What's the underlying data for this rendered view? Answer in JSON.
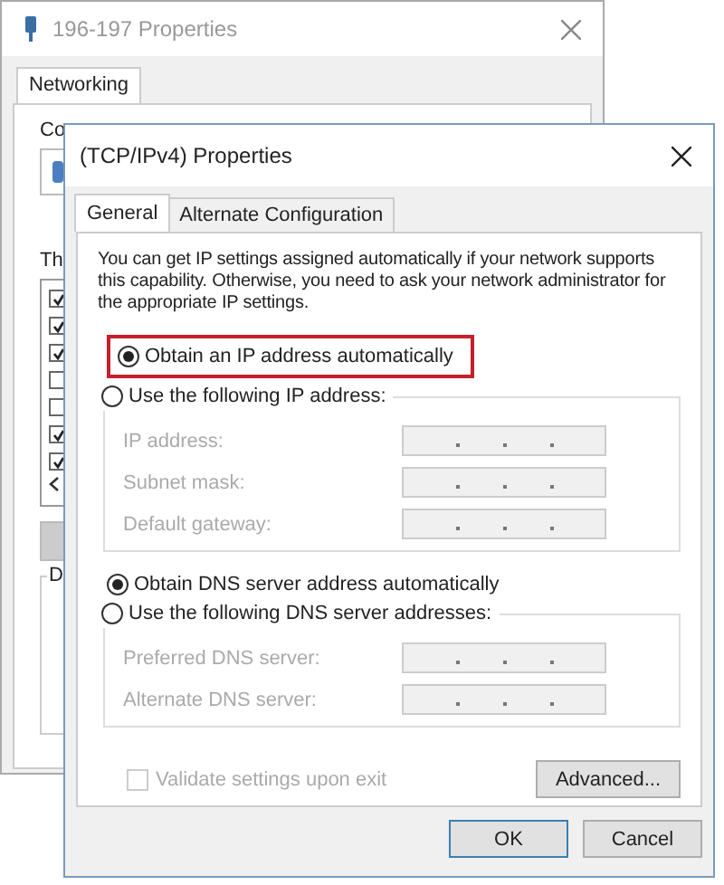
{
  "background_window": {
    "title": "196-197 Properties",
    "tabs": [
      {
        "label": "Networking",
        "selected": true
      }
    ],
    "label_1": "Co",
    "label_2": "Th",
    "label_3": "D",
    "components": [
      {
        "checked": true
      },
      {
        "checked": true
      },
      {
        "checked": true
      },
      {
        "checked": false
      },
      {
        "checked": false
      },
      {
        "checked": true
      },
      {
        "checked": true
      }
    ]
  },
  "dialog": {
    "title": "(TCP/IPv4) Properties",
    "tabs": [
      {
        "label": "General",
        "selected": true
      },
      {
        "label": "Alternate Configuration",
        "selected": false
      }
    ],
    "intro": "You can get IP settings assigned automatically if your network supports this capability. Otherwise, you need to ask your network administrator for the appropriate IP settings.",
    "ip_mode": [
      {
        "label": "Obtain an IP address automatically",
        "selected": true,
        "highlighted": true
      },
      {
        "label": "Use the following IP address:",
        "selected": false,
        "highlighted": false
      }
    ],
    "ip_fields": [
      {
        "label": "IP address:",
        "disabled": true
      },
      {
        "label": "Subnet mask:",
        "disabled": true
      },
      {
        "label": "Default gateway:",
        "disabled": true
      }
    ],
    "dns_mode": [
      {
        "label": "Obtain DNS server address automatically",
        "selected": true,
        "highlighted": false
      },
      {
        "label": "Use the following DNS server addresses:",
        "selected": false,
        "highlighted": false
      }
    ],
    "dns_fields": [
      {
        "label": "Preferred DNS server:",
        "disabled": true
      },
      {
        "label": "Alternate DNS server:",
        "disabled": true
      }
    ],
    "validate": {
      "label": "Validate settings upon exit",
      "checked": false,
      "disabled": true
    },
    "advanced_button": "Advanced...",
    "buttons": [
      {
        "label": "OK",
        "default": true
      },
      {
        "label": "Cancel",
        "default": false
      }
    ]
  }
}
